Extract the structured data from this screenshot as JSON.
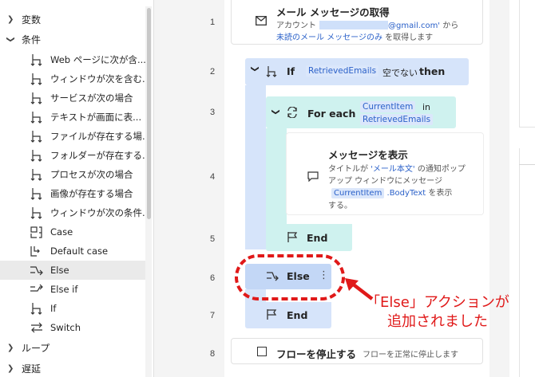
{
  "sidebar": {
    "groups": [
      {
        "label": "変数",
        "expanded": false
      },
      {
        "label": "条件",
        "expanded": true
      },
      {
        "label": "ループ",
        "expanded": false
      },
      {
        "label": "遅延",
        "expanded": false
      }
    ],
    "condition_items": [
      {
        "label": "Web ページに次が含...",
        "icon": "if-icon"
      },
      {
        "label": "ウィンドウが次を含む...",
        "icon": "if-icon"
      },
      {
        "label": "サービスが次の場合",
        "icon": "if-icon"
      },
      {
        "label": "テキストが画面に表...",
        "icon": "if-icon"
      },
      {
        "label": "ファイルが存在する場...",
        "icon": "if-icon"
      },
      {
        "label": "フォルダーが存在する...",
        "icon": "if-icon"
      },
      {
        "label": "プロセスが次の場合",
        "icon": "if-icon"
      },
      {
        "label": "画像が存在する場合",
        "icon": "if-icon"
      },
      {
        "label": "ウィンドウが次の条件...",
        "icon": "if-icon"
      },
      {
        "label": "Case",
        "icon": "case-icon"
      },
      {
        "label": "Default case",
        "icon": "default-case-icon"
      },
      {
        "label": "Else",
        "icon": "else-icon",
        "selected": true
      },
      {
        "label": "Else if",
        "icon": "else-if-icon"
      },
      {
        "label": "If",
        "icon": "if-icon"
      },
      {
        "label": "Switch",
        "icon": "switch-icon"
      }
    ]
  },
  "flow": {
    "line_numbers": [
      "1",
      "2",
      "3",
      "4",
      "5",
      "6",
      "7",
      "8"
    ],
    "step1": {
      "title": "メール メッセージの取得",
      "line1_prefix": "アカウント",
      "line1_email": "@gmail.com'",
      "line1_suffix": "から",
      "line2_link": "未読のメール メッセージのみ",
      "line2_suffix": "を取得します"
    },
    "step2": {
      "keyword": "If",
      "variable": "RetrievedEmails",
      "condition": "空でない",
      "then": "then"
    },
    "step3": {
      "keyword": "For each",
      "variable": "CurrentItem",
      "in": "in",
      "collection": "RetrievedEmails"
    },
    "step4": {
      "title": "メッセージを表示",
      "line1_prefix": "タイトルが",
      "line1_value": "'メール本文'",
      "line1_suffix": "の通知ポップ",
      "line2": "アップ ウィンドウにメッセージ",
      "line3_token": "CurrentItem",
      "line3_prop": ".BodyText",
      "line3_suffix": "を表示",
      "line4": "する。"
    },
    "step5": {
      "label": "End"
    },
    "step6": {
      "label": "Else",
      "menu": "⋮"
    },
    "step7": {
      "label": "End"
    },
    "step8": {
      "title": "フローを停止する",
      "desc": "フローを正常に停止します"
    }
  },
  "annotation": {
    "line1": "「Else」アクションが",
    "line2": "追加されました",
    "color": "#e01919"
  },
  "colors": {
    "if_block": "#d6e4fa",
    "loop_block": "#cff2ef",
    "token_bg": "#dbe7fb",
    "token_text": "#2b61c9"
  }
}
